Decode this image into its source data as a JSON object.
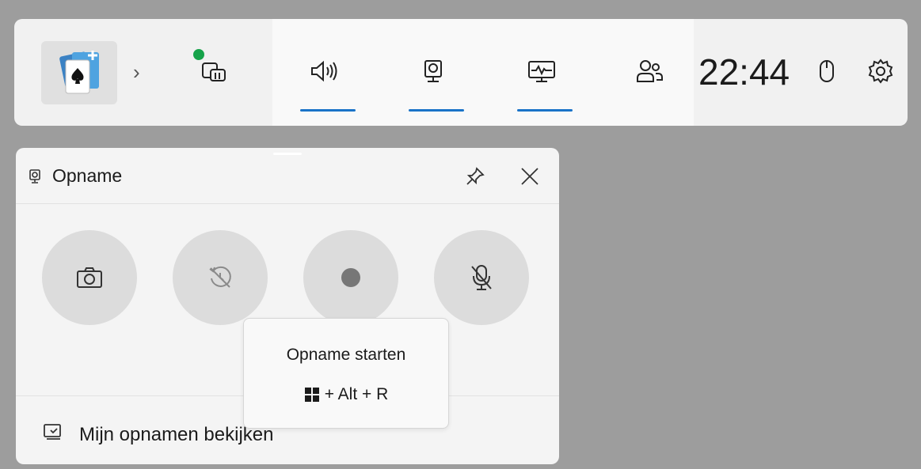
{
  "topbar": {
    "clock": "22:44",
    "icons": [
      "solitaire-app-icon",
      "expand-chevron-icon",
      "widget-icon",
      "audio-icon",
      "capture-icon",
      "performance-icon",
      "social-icon",
      "mouse-icon",
      "settings-icon"
    ],
    "accent": "#1a73c8",
    "status_dot_color": "#16a34a"
  },
  "panel": {
    "title": "Opname",
    "buttons": [
      "screenshot-button",
      "record-last-button",
      "start-recording-button",
      "mic-toggle-button"
    ],
    "footer_label": "Mijn opnamen bekijken"
  },
  "tooltip": {
    "title": "Opname starten",
    "shortcut": "+ Alt + R"
  }
}
